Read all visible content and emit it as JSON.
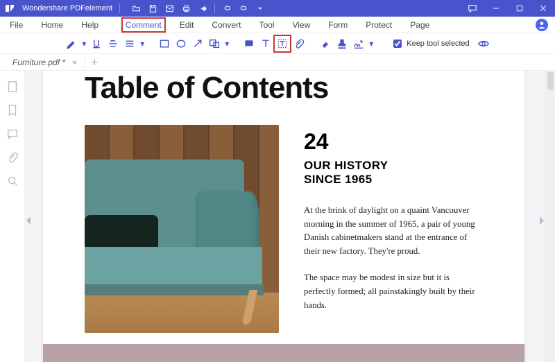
{
  "app": {
    "name": "Wondershare PDFelement"
  },
  "menus": {
    "left": [
      "File",
      "Home",
      "Help"
    ],
    "center": [
      "Comment",
      "Edit",
      "Convert",
      "Tool",
      "View",
      "Form",
      "Protect",
      "Page"
    ],
    "active": "Comment"
  },
  "toolbar": {
    "keep_label": "Keep tool selected",
    "keep_checked": true,
    "selected_tool": "typewriter"
  },
  "tab": {
    "label": "Furniture.pdf *"
  },
  "doc": {
    "title": "Table of Contents",
    "section_number": "24",
    "section_title": "OUR HISTORY\nSINCE 1965",
    "p1": "At the brink of daylight on a quaint Vancouver morning in the summer of 1965, a pair of young Danish cabinetmakers stand at the entrance of their new factory. They're proud.",
    "p2": "The space may be modest in size but it is perfectly formed; all painstakingly built by their hands."
  }
}
